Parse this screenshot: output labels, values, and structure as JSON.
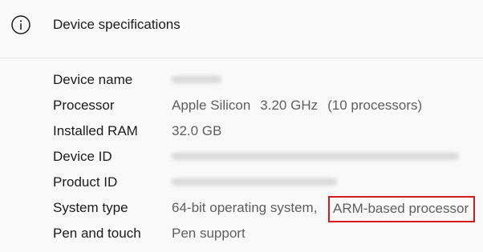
{
  "section": {
    "title": "Device specifications",
    "icon": "info-icon"
  },
  "rows": [
    {
      "label": "Device name",
      "value": "",
      "redacted": true
    },
    {
      "label": "Processor",
      "value_parts": [
        "Apple Silicon",
        "3.20 GHz",
        "(10 processors)"
      ]
    },
    {
      "label": "Installed RAM",
      "value": "32.0 GB"
    },
    {
      "label": "Device ID",
      "value": "",
      "redacted": true
    },
    {
      "label": "Product ID",
      "value": "",
      "redacted": true
    },
    {
      "label": "System type",
      "value": "64-bit operating system,",
      "highlight": "ARM-based processor"
    },
    {
      "label": "Pen and touch",
      "value": "Pen support"
    }
  ],
  "colors": {
    "background": "#f9f9f9",
    "label": "#1b1b1b",
    "value": "#5f5f5f",
    "highlight_border": "#d71920",
    "divider": "#e5e5e5"
  }
}
